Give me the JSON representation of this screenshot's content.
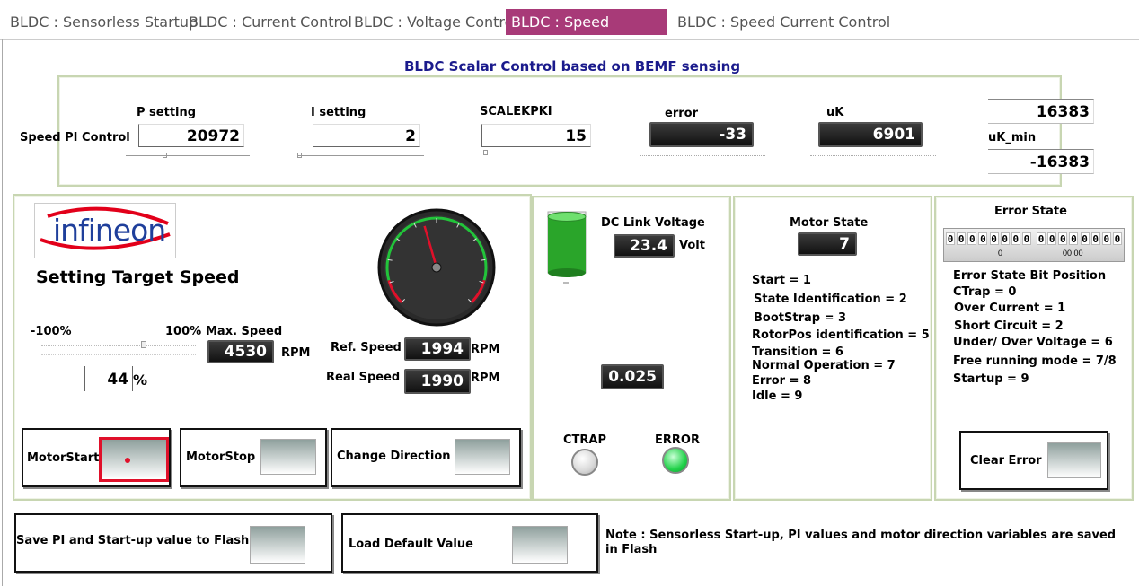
{
  "tabs": [
    "BLDC : Sensorless Startup",
    "BLDC : Current  Control",
    "BLDC : Voltage Control",
    "BLDC : Speed Control",
    "BLDC : Speed Current Control"
  ],
  "title": "BLDC Scalar Control based on BEMF sensing",
  "pi": {
    "section_label": "Speed PI Control",
    "p_label": "P setting",
    "p_value": "20972",
    "i_label": "I setting",
    "i_value": "2",
    "scale_label": "SCALEKPKI",
    "scale_value": "15",
    "error_label": "error",
    "error_value": "-33",
    "uk_label": "uK",
    "uk_value": "6901",
    "uk_max_value": "16383",
    "uk_min_label": "uK_min",
    "uk_min_value": "-16383"
  },
  "speed": {
    "logo_text": "infineon",
    "heading": "Setting Target Speed",
    "min_label": "-100%",
    "max_label": "100%",
    "max_speed_label": "Max. Speed",
    "max_speed_value": "4530",
    "rpm": "RPM",
    "percent_value": "44",
    "percent_sign": "%",
    "ref_label": "Ref. Speed",
    "ref_value": "1994",
    "real_label": "Real Speed",
    "real_value": "1990",
    "gauge_fraction": 0.44,
    "start_label": "MotorStart",
    "stop_label": "MotorStop",
    "dir_label": "Change Direction"
  },
  "dc": {
    "label": "DC Link Voltage",
    "value": "23.4",
    "unit": "Volt",
    "small_value": "0.025",
    "ctrap_label": "CTRAP",
    "error_label": "ERROR",
    "tank_level": 0.92,
    "colors": {
      "led_off": "#d8d8d8",
      "led_on": "#22d24a",
      "tank": "#2aa52a"
    }
  },
  "motor": {
    "label": "Motor State",
    "value": "7",
    "states": [
      "Start = 1",
      "State Identification = 2",
      "BootStrap = 3",
      "RotorPos identification = 5",
      "Transition = 6",
      "Normal Operation = 7",
      "Error = 8",
      "Idle = 9"
    ]
  },
  "error_state": {
    "label": "Error State",
    "bits": [
      "0",
      "0",
      "0",
      "0",
      "0",
      "0",
      "0",
      "0",
      "0",
      "0",
      "0",
      "0",
      "0",
      "0",
      "0",
      "0"
    ],
    "sub_left": "0",
    "sub_right": "00 00",
    "bitpos_label": "Error State Bit Position",
    "items": [
      "CTrap = 0",
      "Over Current = 1",
      "Short Circuit = 2",
      "Under/ Over Voltage = 6",
      "Free running mode = 7/8",
      "Startup = 9"
    ],
    "clear_label": "Clear Error"
  },
  "bottom": {
    "save_label": "Save PI and Start-up value to Flash",
    "load_label": "Load Default Value",
    "note": "Note : Sensorless Start-up,  PI values and motor direction variables are saved in Flash"
  },
  "colors": {
    "accent": "#a83a78",
    "title": "#1a1a8c",
    "frame": "#c8d6b2",
    "logo_red": "#e2001a",
    "logo_blue": "#1f3f9b"
  }
}
